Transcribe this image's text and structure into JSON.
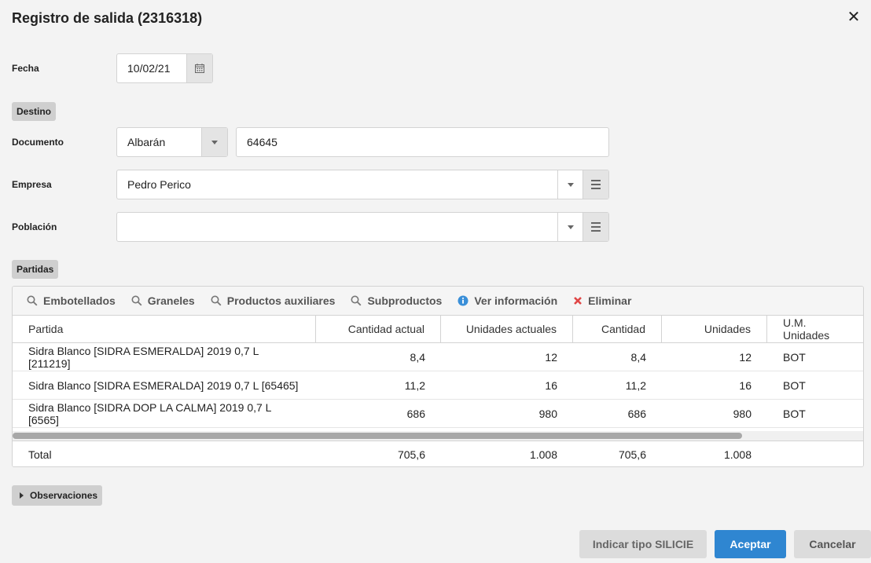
{
  "dialog": {
    "title": "Registro de salida (2316318)"
  },
  "fecha": {
    "label": "Fecha",
    "value": "10/02/21"
  },
  "destino": {
    "label": "Destino"
  },
  "documento": {
    "label": "Documento",
    "type_value": "Albarán",
    "number_value": "64645"
  },
  "empresa": {
    "label": "Empresa",
    "value": "Pedro Perico"
  },
  "poblacion": {
    "label": "Población",
    "value": ""
  },
  "partidas": {
    "label": "Partidas",
    "toolbar": [
      {
        "label": "Embotellados",
        "icon": "search-icon"
      },
      {
        "label": "Graneles",
        "icon": "search-icon"
      },
      {
        "label": "Productos auxiliares",
        "icon": "search-icon"
      },
      {
        "label": "Subproductos",
        "icon": "search-icon"
      },
      {
        "label": "Ver información",
        "icon": "info-icon"
      },
      {
        "label": "Eliminar",
        "icon": "delete-icon"
      }
    ],
    "columns": [
      "Partida",
      "Cantidad actual",
      "Unidades actuales",
      "Cantidad",
      "Unidades",
      "U.M. Unidades"
    ],
    "rows": [
      [
        "Sidra Blanco [SIDRA ESMERALDA] 2019 0,7 L [211219]",
        "8,4",
        "12",
        "8,4",
        "12",
        "BOT"
      ],
      [
        "Sidra Blanco [SIDRA ESMERALDA] 2019 0,7 L [65465]",
        "11,2",
        "16",
        "11,2",
        "16",
        "BOT"
      ],
      [
        "Sidra Blanco [SIDRA DOP LA CALMA] 2019 0,7 L [6565]",
        "686",
        "980",
        "686",
        "980",
        "BOT"
      ]
    ],
    "total": [
      "Total",
      "705,6",
      "1.008",
      "705,6",
      "1.008",
      ""
    ]
  },
  "observaciones": {
    "label": "Observaciones"
  },
  "buttons": {
    "silicie": "Indicar tipo SILICIE",
    "accept": "Aceptar",
    "cancel": "Cancelar"
  },
  "colors": {
    "primary": "#2f86d1",
    "info": "#3a8fd8",
    "delete": "#e04646"
  }
}
